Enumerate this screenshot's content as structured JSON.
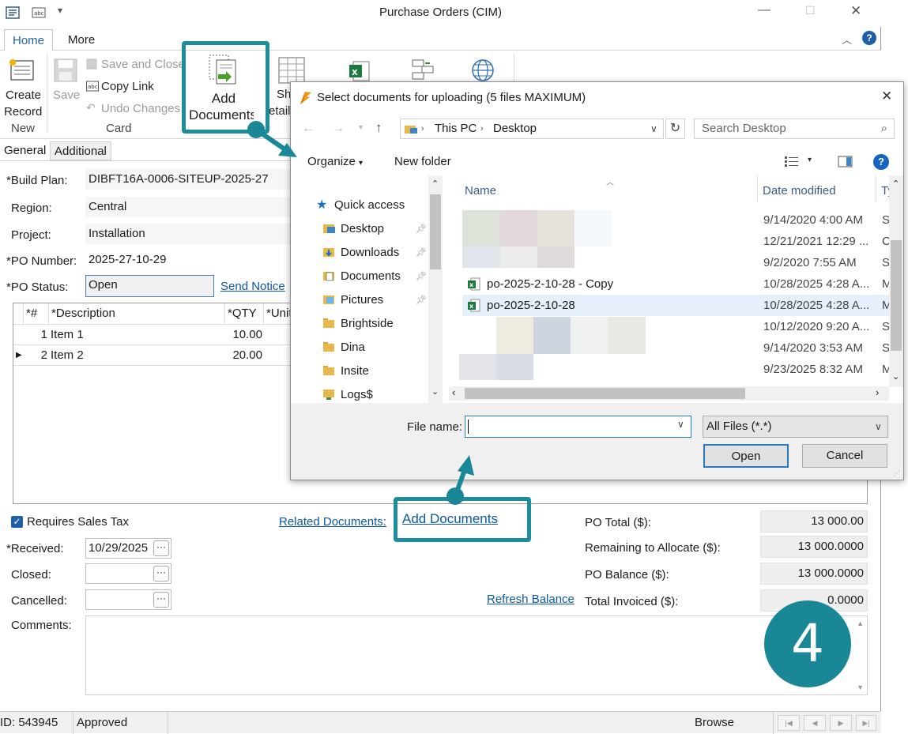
{
  "window": {
    "title": "Purchase Orders (CIM)",
    "help_glyph": "?",
    "min_glyph": "—",
    "max_glyph": "☐",
    "close_glyph": "✕"
  },
  "ribbon_tabs": [
    "Home",
    "More"
  ],
  "ribbon": {
    "create_record_1": "Create",
    "create_record_2": "Record",
    "save": "Save",
    "save_and_close": "Save and Close",
    "copy_link": "Copy Link",
    "undo_changes": "Undo Changes",
    "add_documents_1": "Add",
    "add_documents_2": "Documents",
    "show_details_part": "Sh",
    "details_part": "etail",
    "group_new": "New",
    "group_card": "Card"
  },
  "subtabs": [
    "General",
    "Additional"
  ],
  "form": {
    "build_plan_label": "*Build Plan:",
    "build_plan": "DIBFT16A-0006-SITEUP-2025-27",
    "region_label": "Region:",
    "region": "Central",
    "project_label": "Project:",
    "project": "Installation",
    "po_number_label": "*PO Number:",
    "po_number": "2025-27-10-29",
    "po_status_label": "*PO Status:",
    "po_status": "Open",
    "send_notice": "Send Notice"
  },
  "grid": {
    "headers": [
      "*#",
      "*Description",
      "*QTY",
      "*Unit"
    ],
    "rows": [
      {
        "num": "1",
        "desc": "Item 1",
        "qty": "10.00"
      },
      {
        "num": "2",
        "desc": "Item 2",
        "qty": "20.00"
      }
    ]
  },
  "bottom": {
    "requires_sales_tax": "Requires Sales Tax",
    "related_documents": "Related Documents:",
    "add_documents_link": "Add Documents",
    "received_label": "*Received:",
    "received": "10/29/2025",
    "closed_label": "Closed:",
    "cancelled_label": "Cancelled:",
    "refresh_balance": "Refresh Balance",
    "comments_label": "Comments:",
    "po_total_label": "PO Total ($):",
    "po_total": "13 000.00",
    "remaining_label": "Remaining to Allocate ($):",
    "remaining": "13 000.0000",
    "po_balance_label": "PO Balance ($):",
    "po_balance": "13 000.0000",
    "total_invoiced_label": "Total Invoiced ($):",
    "total_invoiced": "0.0000",
    "dots": "···"
  },
  "status": {
    "id": "ID: 543945",
    "state": "Approved",
    "mode": "Browse"
  },
  "dialog": {
    "title": "Select documents for uploading (5 files MAXIMUM)",
    "breadcrumb_1": "This PC",
    "breadcrumb_2": "Desktop",
    "search_placeholder": "Search Desktop",
    "organize": "Organize",
    "new_folder": "New folder",
    "col_name": "Name",
    "col_date": "Date modified",
    "col_type": "Ty",
    "nav": [
      {
        "label": "Quick access",
        "pin": false
      },
      {
        "label": "Desktop",
        "pin": true
      },
      {
        "label": "Downloads",
        "pin": true
      },
      {
        "label": "Documents",
        "pin": true
      },
      {
        "label": "Pictures",
        "pin": true
      },
      {
        "label": "Brightside",
        "pin": false
      },
      {
        "label": "Dina",
        "pin": false
      },
      {
        "label": "Insite",
        "pin": false
      },
      {
        "label": "Logs$",
        "pin": false
      }
    ],
    "files": [
      {
        "name": "",
        "date": "9/14/2020 4:00 AM",
        "type": "S"
      },
      {
        "name": "",
        "date": "12/21/2021 12:29 ...",
        "type": "C"
      },
      {
        "name": "",
        "date": "9/2/2020 7:55 AM",
        "type": "S"
      },
      {
        "name": "po-2025-2-10-28 - Copy",
        "date": "10/28/2025 4:28 A...",
        "type": "M"
      },
      {
        "name": "po-2025-2-10-28",
        "date": "10/28/2025 4:28 A...",
        "type": "M"
      },
      {
        "name": "",
        "date": "10/12/2020 9:20 A...",
        "type": "S"
      },
      {
        "name": "",
        "date": "9/14/2020 3:53 AM",
        "type": "S"
      },
      {
        "name": "",
        "date": "9/23/2025 8:32 AM",
        "type": "M"
      }
    ],
    "file_name_label": "File name:",
    "file_name_value": "",
    "filter": "All Files (*.*)",
    "open": "Open",
    "cancel": "Cancel"
  },
  "annotation": {
    "step": "4",
    "color": "#1c8e9b"
  }
}
